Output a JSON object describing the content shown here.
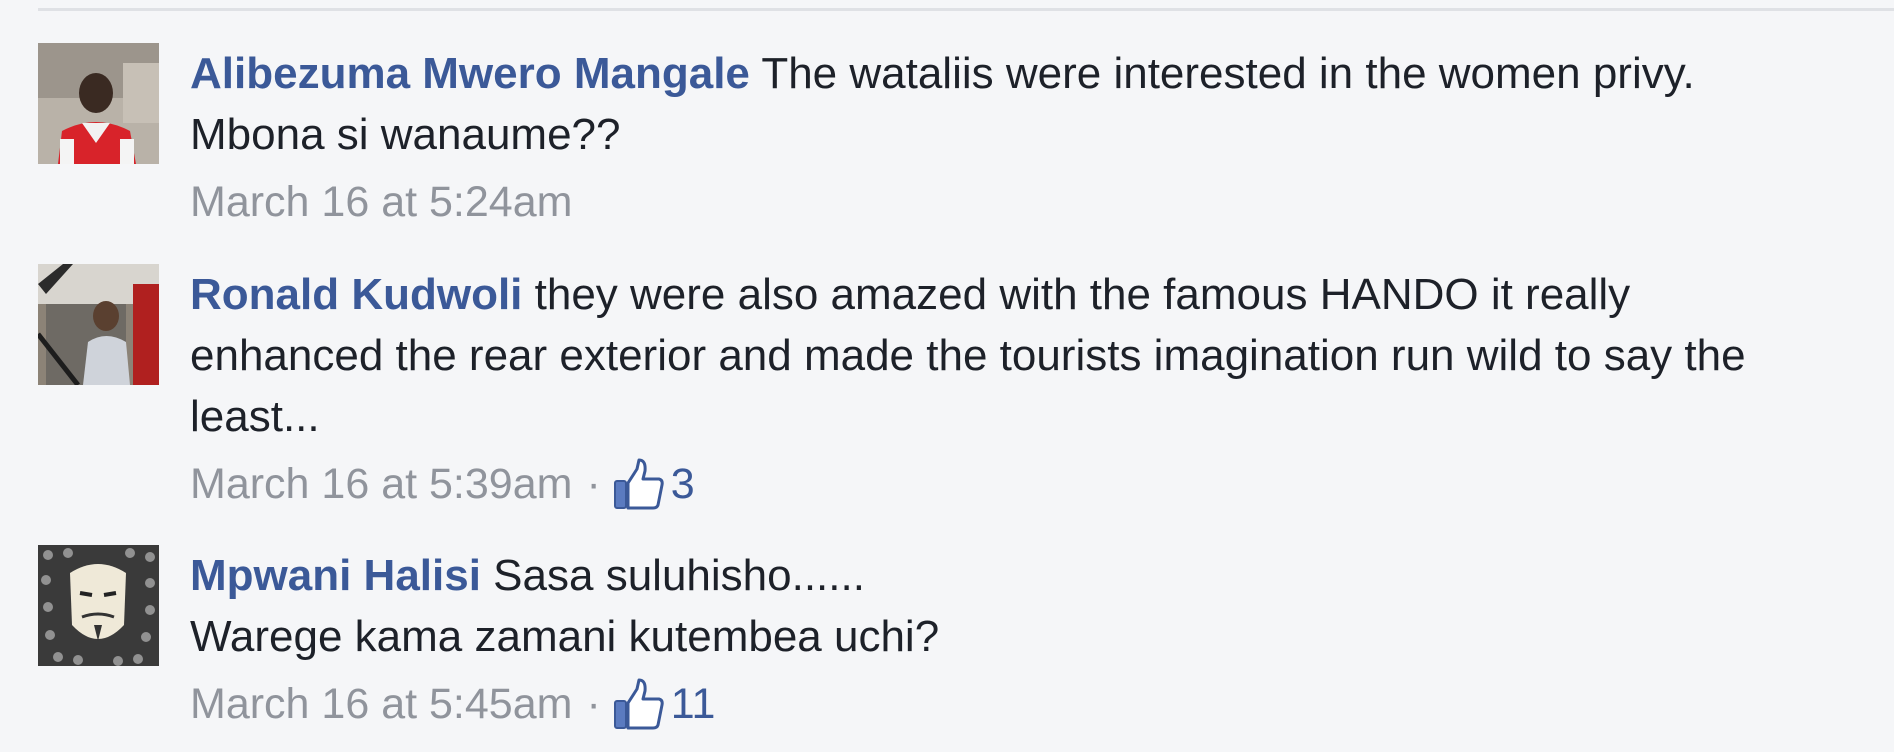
{
  "colors": {
    "background": "#f5f6f8",
    "author": "#3b5998",
    "text": "#1d2129",
    "meta": "#90949c",
    "divider": "#dfe1e5"
  },
  "comments": [
    {
      "author": "Alibezuma Mwero Mangale",
      "text_line1": " The wataliis were interested in the women privy.",
      "text_line2": "Mbona si wanaume??",
      "timestamp": "March 16 at 5:24am",
      "likes": null,
      "avatar_icon": "profile-photo-red-shirt"
    },
    {
      "author": "Ronald Kudwoli",
      "text_line1": " they were also amazed with the famous HANDO it really",
      "text_line2": "enhanced the rear exterior and made the tourists imagination run wild to say the",
      "text_line3": "least...",
      "timestamp": "March 16 at 5:39am",
      "separator": "·",
      "likes": "3",
      "like_icon": "thumbs-up-icon",
      "avatar_icon": "profile-photo-vehicle"
    },
    {
      "author": "Mpwani Halisi",
      "text_line1": " Sasa suluhisho......",
      "text_line2": "Warege kama zamani kutembea uchi?",
      "timestamp": "March 16 at 5:45am",
      "separator": "·",
      "likes": "11",
      "like_icon": "thumbs-up-icon",
      "avatar_icon": "profile-photo-mask"
    }
  ]
}
